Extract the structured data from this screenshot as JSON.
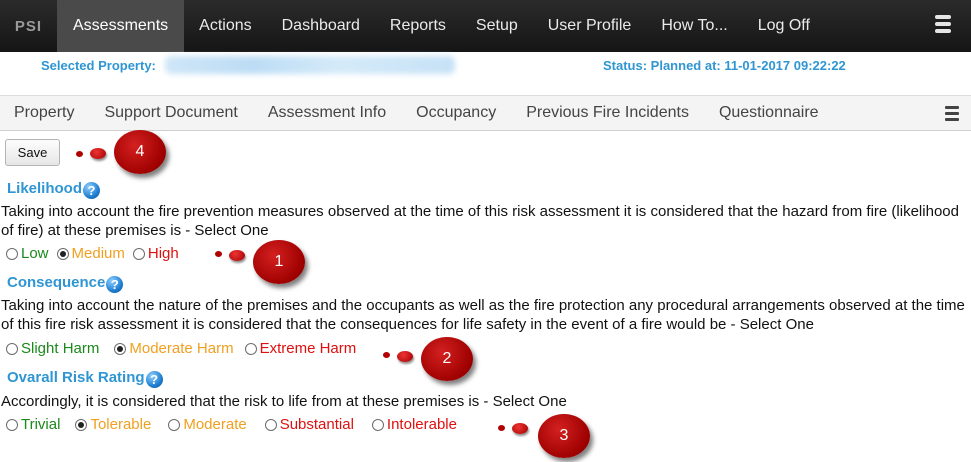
{
  "nav": {
    "brand": "PSI",
    "items": [
      "Assessments",
      "Actions",
      "Dashboard",
      "Reports",
      "Setup",
      "User Profile",
      "How To...",
      "Log Off"
    ],
    "active_index": 0,
    "menu_icon": "hamburger-icon"
  },
  "property": {
    "label": "Selected Property:",
    "status": "Status: Planned at: 11-01-2017 09:22:22"
  },
  "subtabs": {
    "items": [
      "Property",
      "Support Document",
      "Assessment Info",
      "Occupancy",
      "Previous Fire Incidents",
      "Questionnaire"
    ],
    "menu_icon": "hamburger-icon"
  },
  "toolbar": {
    "save_label": "Save"
  },
  "likelihood": {
    "heading": "Likelihood",
    "description": "Taking into account the fire prevention measures observed at the time of this risk assessment it is considered that the hazard from fire (likelihood of fire) at these premises is - Select One",
    "options": [
      {
        "label": "Low",
        "color": "#1a8a1a",
        "checked": false
      },
      {
        "label": "Medium",
        "color": "#f0a020",
        "checked": true
      },
      {
        "label": "High",
        "color": "#e01010",
        "checked": false
      }
    ]
  },
  "consequence": {
    "heading": "Consequence",
    "description": "Taking into account the nature of the premises and the occupants as well as the fire protection any procedural arrangements observed at the time of this fire risk assessment it is considered that the consequences for life safety in the event of a fire would be - Select One",
    "options": [
      {
        "label": "Slight Harm",
        "color": "#1a8a1a",
        "checked": false
      },
      {
        "label": "Moderate Harm",
        "color": "#f0a020",
        "checked": true
      },
      {
        "label": "Extreme Harm",
        "color": "#e01010",
        "checked": false
      }
    ]
  },
  "overall": {
    "heading": "Ovarall Risk Rating",
    "description": "Accordingly, it is considered that the risk to life from at these premises is - Select One",
    "options": [
      {
        "label": "Trivial",
        "color": "#1a8a1a",
        "checked": false
      },
      {
        "label": "Tolerable",
        "color": "#f0a020",
        "checked": true
      },
      {
        "label": "Moderate",
        "color": "#f0a020",
        "checked": false
      },
      {
        "label": "Substantial",
        "color": "#e01010",
        "checked": false
      },
      {
        "label": "Intolerable",
        "color": "#e01010",
        "checked": false
      }
    ]
  },
  "callouts": [
    "4",
    "1",
    "2",
    "3"
  ],
  "help_icon_glyph": "?",
  "colors": {
    "accent": "#2f96d3",
    "nav_bg": "#1e1e1e",
    "callout": "#b00000"
  }
}
